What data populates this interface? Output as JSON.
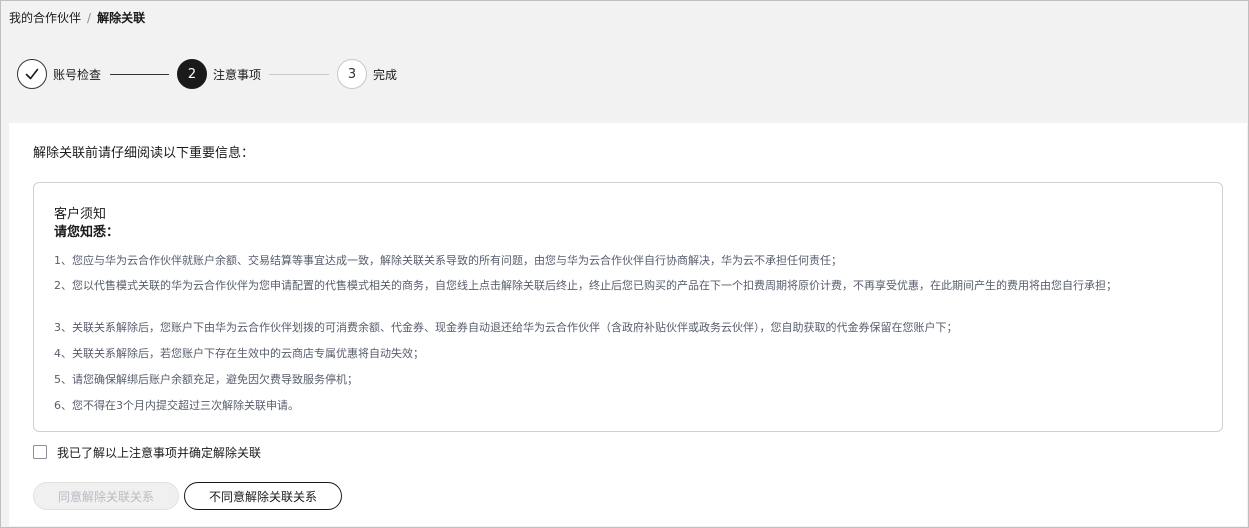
{
  "breadcrumb": {
    "parent": "我的合作伙伴",
    "separator": "/",
    "current": "解除关联"
  },
  "steps": [
    {
      "number": "1",
      "label": "账号检查",
      "status": "done",
      "icon": "check-icon"
    },
    {
      "number": "2",
      "label": "注意事项",
      "status": "active"
    },
    {
      "number": "3",
      "label": "完成",
      "status": "pending"
    }
  ],
  "intro": "解除关联前请仔细阅读以下重要信息：",
  "notice": {
    "title": "客户须知",
    "subtitle": "请您知悉：",
    "items": [
      "1、您应与华为云合作伙伴就账户余额、交易结算等事宜达成一致，解除关联关系导致的所有问题，由您与华为云合作伙伴自行协商解决，华为云不承担任何责任；",
      "2、您以代售模式关联的华为云合作伙伴为您申请配置的代售模式相关的商务，自您线上点击解除关联后终止，终止后您已购买的产品在下一个扣费周期将原价计费，不再享受优惠，在此期间产生的费用将由您自行承担；",
      "3、关联关系解除后，您账户下由华为云合作伙伴划拨的可消费余额、代金券、现金券自动退还给华为云合作伙伴（含政府补贴伙伴或政务云伙伴），您自助获取的代金券保留在您账户下；",
      "4、关联关系解除后，若您账户下存在生效中的云商店专属优惠将自动失效；",
      "5、请您确保解绑后账户余额充足，避免因欠费导致服务停机；",
      "6、您不得在3个月内提交超过三次解除关联申请。"
    ]
  },
  "agree_checkbox": {
    "label": "我已了解以上注意事项并确定解除关联",
    "checked": false
  },
  "buttons": {
    "agree": "同意解除关联关系",
    "disagree": "不同意解除关联关系"
  },
  "colors": {
    "active_step": "#1a1a1a",
    "page_bg": "#f2f2f2",
    "disabled_text": "#b8bbc2"
  }
}
